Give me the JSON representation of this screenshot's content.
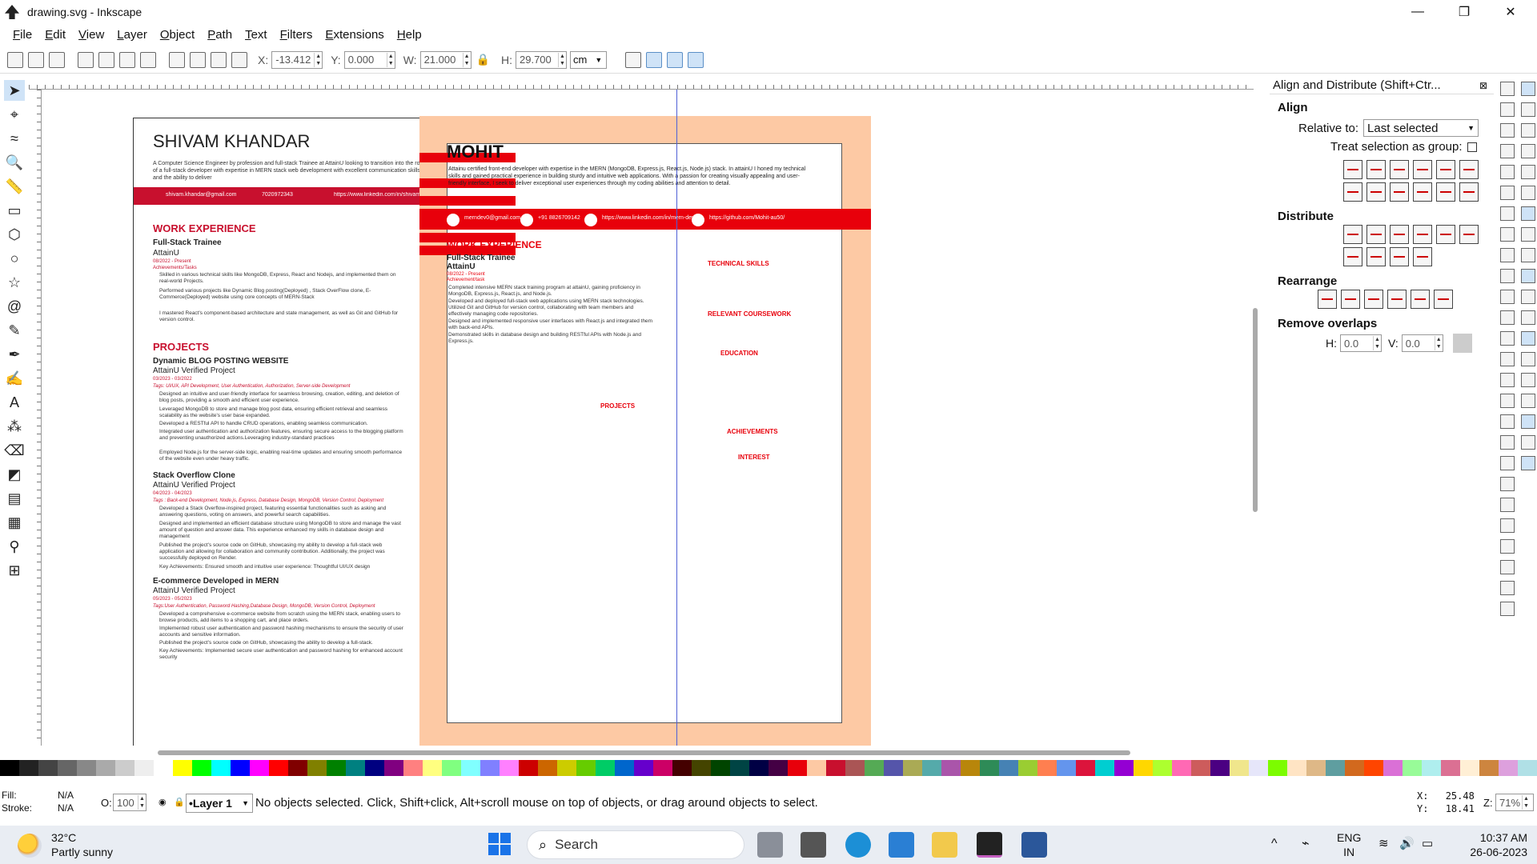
{
  "window": {
    "title": "drawing.svg - Inkscape",
    "minimize": "—",
    "maximize": "❐",
    "close": "✕"
  },
  "menu": [
    "File",
    "Edit",
    "View",
    "Layer",
    "Object",
    "Path",
    "Text",
    "Filters",
    "Extensions",
    "Help"
  ],
  "controls": {
    "x_label": "X:",
    "x_value": "-13.412",
    "y_label": "Y:",
    "y_value": "0.000",
    "w_label": "W:",
    "w_value": "21.000",
    "h_label": "H:",
    "h_value": "29.700",
    "unit": "cm"
  },
  "resume1": {
    "name": "SHIVAM KHANDAR",
    "summary": "A Computer Science Engineer by profession and full-stack Trainee at AttainU looking to transition into the role of a full-stack developer with expertise in MERN stack web development with excellent communication skills and the ability to deliver",
    "email": "shivam.khandar@gmail.com",
    "phone": "7020972343",
    "linkedin": "https://www.linkedin.com/in/shivam-khandar-176a952",
    "work_heading": "WORK EXPERIENCE",
    "job_title": "Full-Stack Trainee",
    "job_company": "AttainU",
    "job_date": "08/2022 - Present",
    "job_ach": "Achievements/Tasks",
    "job_bullets": [
      "Skilled in various technical skills like MongoDB, Express, React and Nodejs, and implemented them on real-world Projects.",
      "Performed various projects like Dynamic Blog posting(Deployed) , Stack OverFlow clone, E-Commerce(Deployed) website using core concepts of MERN-Stack",
      "I mastered React's component-based architecture and state management, as well as Git and GitHub for version control."
    ],
    "projects_heading": "PROJECTS",
    "p1_title": "Dynamic BLOG POSTING WEBSITE",
    "p1_sub": "AttainU Verified Project",
    "p1_date": "03/2023 - 03/2022",
    "p1_tags": "Tags: UI/UX, API Development, User Authentication, Authorization, Server-side Development",
    "p1_bullets": [
      "Designed an intuitive and user-friendly interface for seamless browsing, creation, editing, and deletion of blog posts, providing a smooth and efficient user experience.",
      "Leveraged MongoDB to store and manage blog post data, ensuring efficient retrieval and seamless scalability as the website's user base expanded.",
      "Developed a RESTful API to handle CRUD operations, enabling seamless communication.",
      "Integrated user authentication and authorization features, ensuring secure access to the blogging platform and preventing unauthorized actions.Leveraging industry-standard practices",
      "Employed Node.js for the server-side logic, enabling real-time updates and ensuring smooth performance of the website even under heavy traffic."
    ],
    "p2_title": "Stack Overflow Clone",
    "p2_sub": "AttainU Verified Project",
    "p2_date": "04/2023 - 04/2023",
    "p2_tags": "Tags : Back-end Development, Node.js, Express, Database Design, MongoDB, Version Control, Deployment",
    "p2_bullets": [
      "Developed a Stack Overflow-inspired project, featuring essential functionalities such as asking and answering questions, voting on answers, and powerful search capabilities.",
      "Designed and implemented an efficient database structure using MongoDB to store and manage the vast amount of question and answer data. This experience enhanced my skills in database design and management",
      "Published the project's source code on GitHub, showcasing my ability to develop a full-stack web application and allowing for collaboration and community contribution. Additionally, the project was successfully deployed on Render.",
      "Key Achievements: Ensured smooth and intuitive user experience: Thoughtful UI/UX design"
    ],
    "p3_title": "E-commerce Developed in MERN",
    "p3_sub": "AttainU Verified Project",
    "p3_date": "05/2023 - 05/2023",
    "p3_tags": "Tags:User Authentication, Password Hashing,Database Design, MongoDB, Version Control, Deployment",
    "p3_bullets": [
      "Developed a comprehensive e-commerce website from scratch using the MERN stack, enabling users to browse products, add items to a shopping cart, and place orders.",
      "Implemented robust user authentication and password hashing mechanisms to ensure the security of user accounts and sensitive information.",
      "Published the project's source code on GitHub, showcasing the ability to develop a full-stack.",
      "Key Achievements: Implemented secure user authentication and password hashing for enhanced account security"
    ]
  },
  "resume2": {
    "name": "MOHIT",
    "summary": "Attainu certified front-end developer with expertise in the MERN (MongoDB, Express.js, React.js, Node.js) stack. In attainU I honed my technical skills and gained practical experience in building sturdy and intuitive web applications. With a passion for creating visually appealing and user-friendly interface, I seek to deliver exceptional user experiences through my coding abilities and attention to detail.",
    "email": "merndev0@gmail.com",
    "phone": "+91 8826709142",
    "linkedin": "https://www.linkedin.com/in/mern-dev/",
    "github": "https://github.com/Mohit-au50/",
    "work_heading": "WORK EXPERIENCE",
    "job_title": "Full-Stack Trainee",
    "job_company": "AttainU",
    "job_date": "08/2022 - Present",
    "job_ach": "Achievement/task",
    "bullets": [
      "Completed intensive MERN stack training program at attainU, gaining proficiency in MongoDB, Express.js, React.js, and Node.js.",
      "Developed and deployed full-stack web applications using MERN stack technologies.",
      "Utilized Git and GitHub for version control, collaborating with team members and effectively managing code repositories.",
      "Designed and implemented responsive user interfaces with React.js and integrated them with back-end APIs.",
      "Demonstrated skills in database design and building RESTful APIs with Node.js and Express.js."
    ],
    "tech": "TECHNICAL SKILLS",
    "course": "RELEVANT COURSEWORK",
    "edu": "EDUCATION",
    "projects": "PROJECTS",
    "ach": "ACHIEVEMENTS",
    "interest": "INTEREST"
  },
  "dock": {
    "title": "Align and Distribute (Shift+Ctr...",
    "align": "Align",
    "relative_label": "Relative to:",
    "relative_value": "Last selected",
    "treat_group": "Treat selection as group:",
    "distribute": "Distribute",
    "rearrange": "Rearrange",
    "remove_overlaps": "Remove overlaps",
    "h_label": "H:",
    "h_value": "0.0",
    "v_label": "V:",
    "v_value": "0.0"
  },
  "status": {
    "fill_label": "Fill:",
    "fill_value": "N/A",
    "stroke_label": "Stroke:",
    "stroke_value": "N/A",
    "opacity_label": "O:",
    "opacity_value": "100",
    "layer": "•Layer 1",
    "message": "No objects selected. Click, Shift+click, Alt+scroll mouse on top of objects, or drag around objects to select.",
    "x_label": "X:",
    "x_coord": "25.48",
    "y_label": "Y:",
    "y_coord": "18.41",
    "zoom_label": "Z:",
    "zoom": "71%"
  },
  "taskbar": {
    "temp": "32°C",
    "weather": "Partly sunny",
    "search": "Search",
    "lang1": "ENG",
    "lang2": "IN",
    "time": "10:37 AM",
    "date": "26-06-2023"
  },
  "colors": {
    "accent_red": "#c8102e",
    "bright_red": "#e8000b",
    "peach": "#fdc9a4",
    "guide": "#4e5fd6"
  }
}
